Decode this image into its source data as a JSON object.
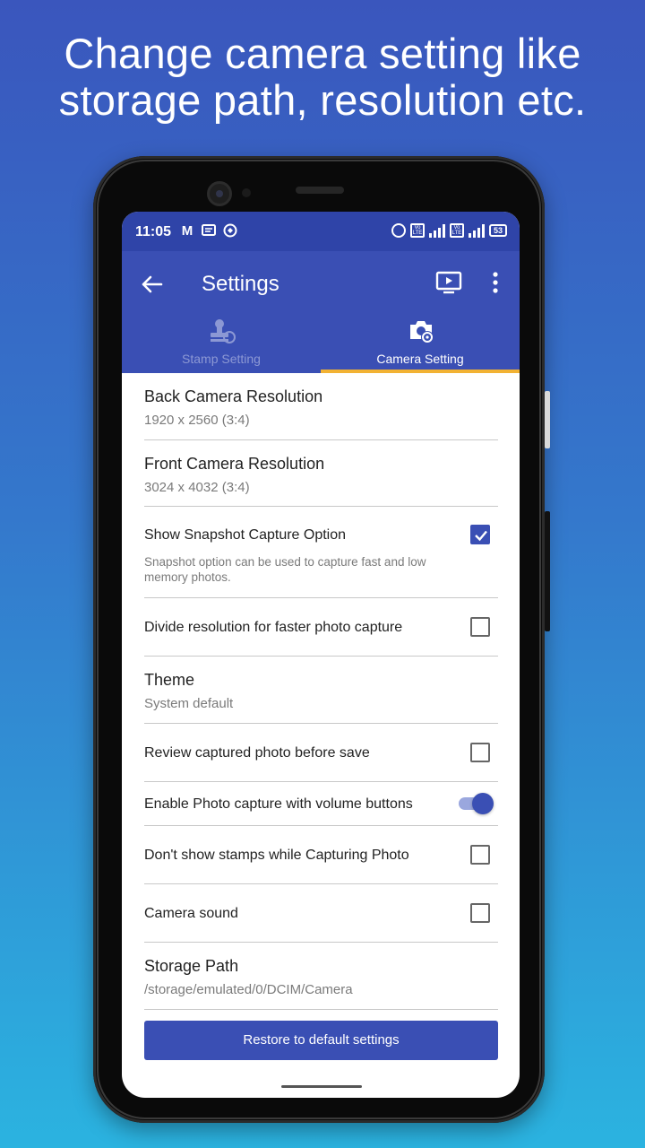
{
  "headline": "Change camera setting like\nstorage path, resolution etc.",
  "status_bar": {
    "time": "11:05",
    "icons_left": [
      "gmail-icon",
      "message-icon",
      "vpn-icon"
    ],
    "icons_right": [
      "alarm-icon",
      "volte-icon",
      "signal-icon",
      "volte-icon",
      "signal-icon"
    ],
    "battery": "53"
  },
  "app_bar": {
    "title": "Settings",
    "tabs": [
      {
        "label": "Stamp Setting",
        "icon": "stamp-icon",
        "selected": false
      },
      {
        "label": "Camera Setting",
        "icon": "camera-settings-icon",
        "selected": true
      }
    ],
    "accent_color": "#3a4fb4",
    "indicator_color": "#f2b233"
  },
  "settings": {
    "back_camera": {
      "title": "Back Camera Resolution",
      "value": "1920 x 2560 (3:4)"
    },
    "front_camera": {
      "title": "Front Camera Resolution",
      "value": "3024 x 4032 (3:4)"
    },
    "snapshot": {
      "title": "Show Snapshot Capture Option",
      "desc": "Snapshot option can be used to capture fast and low memory photos.",
      "checked": true
    },
    "divide_resolution": {
      "label": "Divide resolution for faster photo capture",
      "checked": false
    },
    "theme": {
      "title": "Theme",
      "value": "System default"
    },
    "review_photo": {
      "label": "Review captured photo before save",
      "checked": false
    },
    "volume_capture": {
      "label": "Enable Photo capture with volume buttons",
      "on": true
    },
    "hide_stamps": {
      "label": "Don't show stamps while Capturing Photo",
      "checked": false
    },
    "camera_sound": {
      "label": "Camera sound",
      "checked": false
    },
    "storage_path": {
      "title": "Storage Path",
      "value": "/storage/emulated/0/DCIM/Camera"
    }
  },
  "restore_button": "Restore to default settings"
}
